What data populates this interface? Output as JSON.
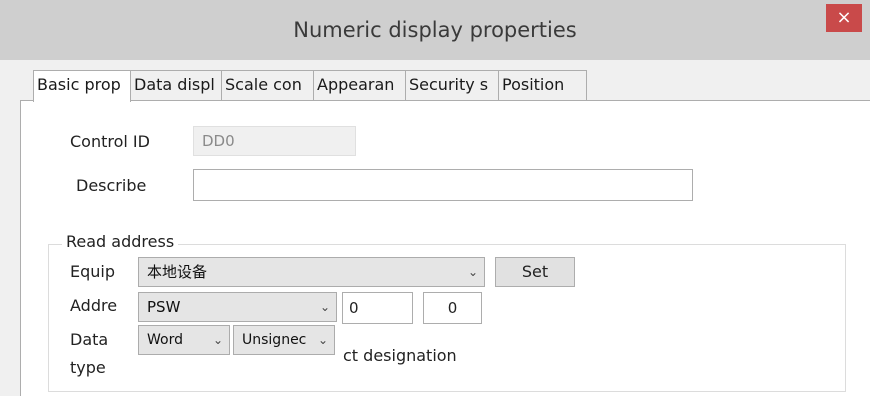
{
  "window": {
    "title": "Numeric display properties",
    "close_symbol": "×"
  },
  "tabs": [
    {
      "label": "Basic prop"
    },
    {
      "label": "Data displ"
    },
    {
      "label": "Scale con"
    },
    {
      "label": "Appearan"
    },
    {
      "label": "Security s"
    },
    {
      "label": "Position"
    }
  ],
  "basic": {
    "control_id_label": "Control ID",
    "control_id_value": "DD0",
    "describe_label": "Describe",
    "describe_value": ""
  },
  "read_address": {
    "group_title": "Read address",
    "equip_label": "Equip",
    "equip_value": "本地设备",
    "set_label": "Set",
    "addr_label": "Addre",
    "addr_value": "PSW",
    "addr_num_1": "0",
    "addr_num_2": "0",
    "data_type_label_1": "Data",
    "data_type_label_2": "type",
    "data_type_value": "Word",
    "sign_value": "Unsignec",
    "designation_text": "ct designation"
  },
  "icons": {
    "dropdown": "chevron-down-icon",
    "close": "close-icon"
  }
}
